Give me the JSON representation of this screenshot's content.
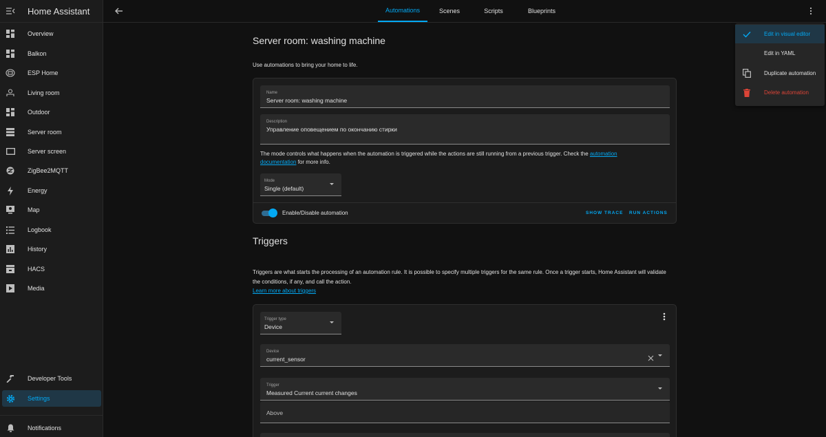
{
  "app": {
    "title": "Home Assistant"
  },
  "sidebar": {
    "items": [
      {
        "label": "Overview",
        "icon": "dashboard-icon"
      },
      {
        "label": "Balkon",
        "icon": "dashboard-icon"
      },
      {
        "label": "ESP Home",
        "icon": "esphome-icon"
      },
      {
        "label": "Living room",
        "icon": "sofa-icon"
      },
      {
        "label": "Outdoor",
        "icon": "dashboard-icon"
      },
      {
        "label": "Server room",
        "icon": "server-icon"
      },
      {
        "label": "Server screen",
        "icon": "screen-icon"
      },
      {
        "label": "ZigBee2MQTT",
        "icon": "zigbee-icon"
      },
      {
        "label": "Energy",
        "icon": "lightning-icon"
      },
      {
        "label": "Map",
        "icon": "map-icon"
      },
      {
        "label": "Logbook",
        "icon": "logbook-icon"
      },
      {
        "label": "History",
        "icon": "history-icon"
      },
      {
        "label": "HACS",
        "icon": "hacs-icon"
      },
      {
        "label": "Media",
        "icon": "media-icon"
      }
    ],
    "developer_tools": "Developer Tools",
    "settings": "Settings",
    "notifications": "Notifications"
  },
  "tabs": [
    {
      "label": "Automations",
      "active": true
    },
    {
      "label": "Scenes",
      "active": false
    },
    {
      "label": "Scripts",
      "active": false
    },
    {
      "label": "Blueprints",
      "active": false
    }
  ],
  "page": {
    "title": "Server room: washing machine",
    "intro": "Use automations to bring your home to life."
  },
  "details": {
    "name_label": "Name",
    "name_value": "Server room: washing machine",
    "description_label": "Description",
    "description_value": "Управление оповещением по окончанию стирки",
    "mode_text_prefix": "The mode controls what happens when the automation is triggered while the actions are still running from a previous trigger. Check the ",
    "mode_link": "automation documentation",
    "mode_text_suffix": " for more info.",
    "mode_label": "Mode",
    "mode_value": "Single (default)",
    "toggle_label": "Enable/Disable automation",
    "toggle_on": true,
    "show_trace": "SHOW TRACE",
    "run_actions": "RUN ACTIONS"
  },
  "triggers": {
    "title": "Triggers",
    "description": "Triggers are what starts the processing of an automation rule. It is possible to specify multiple triggers for the same rule. Once a trigger starts, Home Assistant will validate the conditions, if any, and call the action.",
    "learn_more": "Learn more about triggers",
    "trigger_type_label": "Trigger type",
    "trigger_type_value": "Device",
    "device_label": "Device",
    "device_value": "current_sensor",
    "trigger_label": "Trigger",
    "trigger_value": "Measured Current current changes",
    "above_placeholder": "Above"
  },
  "menu": {
    "items": [
      {
        "label": "Edit in visual editor",
        "icon": "check-icon",
        "selected": true
      },
      {
        "label": "Edit in YAML",
        "icon": "",
        "selected": false
      },
      {
        "label": "Duplicate automation",
        "icon": "duplicate-icon",
        "selected": false
      },
      {
        "label": "Delete automation",
        "icon": "delete-icon",
        "selected": false,
        "danger": true
      }
    ]
  },
  "colors": {
    "accent": "#03a9f4",
    "danger": "#db4437",
    "background": "#111111",
    "card": "#1c1c1c"
  }
}
